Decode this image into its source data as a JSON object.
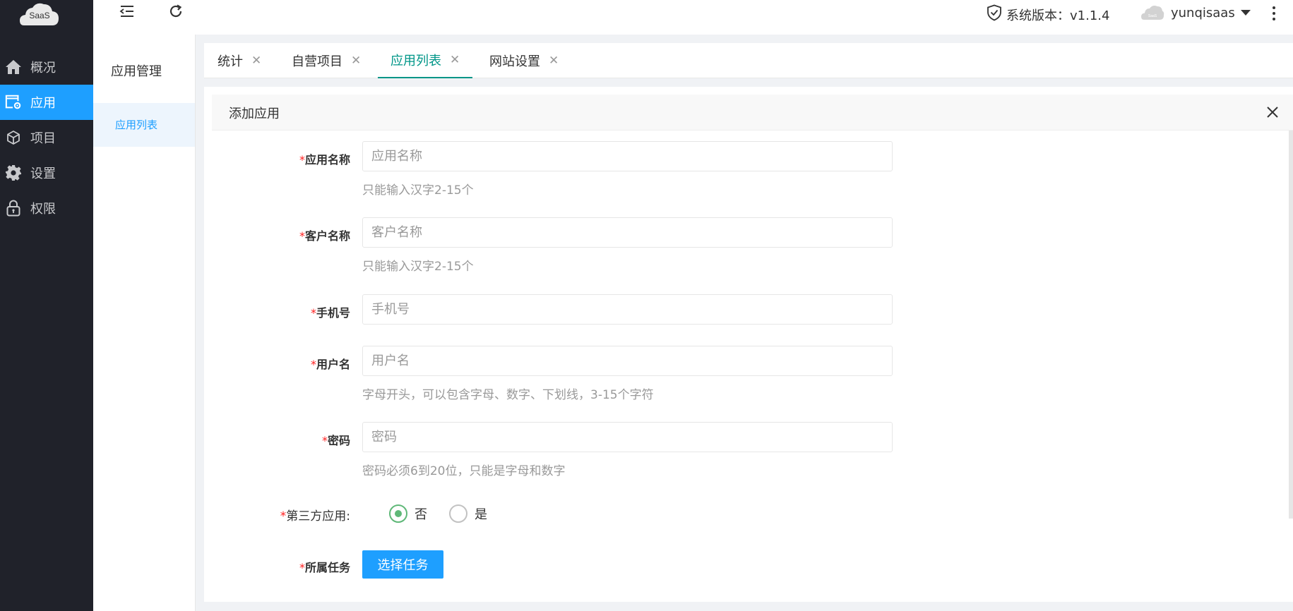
{
  "app": {
    "logo_text": "SaaS",
    "version_label": "系统版本：v1.1.4",
    "username": "yunqisaas"
  },
  "sidebar": {
    "items": [
      {
        "label": "概况",
        "icon": "home-icon",
        "active": false
      },
      {
        "label": "应用",
        "icon": "app-store-icon",
        "active": true
      },
      {
        "label": "项目",
        "icon": "cube-icon",
        "active": false
      },
      {
        "label": "设置",
        "icon": "gear-icon",
        "active": false
      },
      {
        "label": "权限",
        "icon": "lock-icon",
        "active": false
      }
    ]
  },
  "submenu": {
    "title": "应用管理",
    "items": [
      {
        "label": "应用列表",
        "active": true
      }
    ]
  },
  "tabs": [
    {
      "label": "统计",
      "active": false
    },
    {
      "label": "自营项目",
      "active": false
    },
    {
      "label": "应用列表",
      "active": true
    },
    {
      "label": "网站设置",
      "active": false
    }
  ],
  "panel": {
    "title": "添加应用"
  },
  "form": {
    "required_mark": "*",
    "fields": {
      "app_name": {
        "label": "应用名称",
        "placeholder": "应用名称",
        "hint": "只能输入汉字2-15个"
      },
      "customer_name": {
        "label": "客户名称",
        "placeholder": "客户名称",
        "hint": "只能输入汉字2-15个"
      },
      "phone": {
        "label": "手机号",
        "placeholder": "手机号"
      },
      "username": {
        "label": "用户名",
        "placeholder": "用户名",
        "hint": "字母开头，可以包含字母、数字、下划线，3-15个字符"
      },
      "password": {
        "label": "密码",
        "placeholder": "密码",
        "hint": "密码必须6到20位，只能是字母和数字"
      },
      "third_party": {
        "label": "第三方应用:",
        "options": [
          "否",
          "是"
        ],
        "selected": "否"
      },
      "task": {
        "label": "所属任务",
        "button_label": "选择任务"
      }
    }
  },
  "colors": {
    "sidebar_bg": "#20222a",
    "primary": "#1e9fff",
    "tab_active": "#009688",
    "radio_checked": "#5fb878",
    "required": "#ff2020"
  }
}
